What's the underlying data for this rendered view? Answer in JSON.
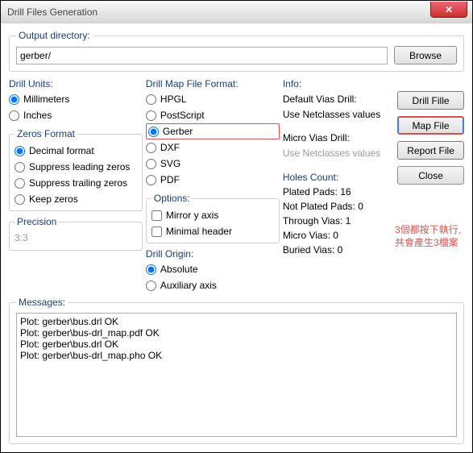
{
  "window": {
    "title": "Drill Files Generation",
    "close_glyph": "✕"
  },
  "output": {
    "legend": "Output directory:",
    "value": "gerber/",
    "browse": "Browse"
  },
  "drill_units": {
    "legend": "Drill Units:",
    "millimeters": "Millimeters",
    "inches": "Inches"
  },
  "zeros": {
    "legend": "Zeros Format",
    "decimal": "Decimal format",
    "sup_lead": "Suppress leading zeros",
    "sup_trail": "Suppress trailing zeros",
    "keep": "Keep zeros"
  },
  "precision": {
    "legend": "Precision",
    "value": "3:3"
  },
  "map_format": {
    "legend": "Drill Map File Format:",
    "hpgl": "HPGL",
    "postscript": "PostScript",
    "gerber": "Gerber",
    "dxf": "DXF",
    "svg": "SVG",
    "pdf": "PDF"
  },
  "options": {
    "legend": "Options:",
    "mirror": "Mirror y axis",
    "minimal": "Minimal header"
  },
  "origin": {
    "legend": "Drill Origin:",
    "absolute": "Absolute",
    "aux": "Auxiliary axis"
  },
  "info": {
    "legend": "Info:",
    "default_vias": "Default Vias Drill:",
    "use_net1": "Use Netclasses values",
    "micro_vias": "Micro Vias Drill:",
    "use_net2": "Use Netclasses values",
    "holes_legend": "Holes Count:",
    "plated": "Plated Pads: 16",
    "notplated": "Not Plated Pads: 0",
    "through": "Through Vias: 1",
    "micro": "Micro Vias: 0",
    "buried": "Buried Vias: 0"
  },
  "buttons": {
    "drill": "Drill Fille",
    "map": "Map File",
    "report": "Report File",
    "close": "Close"
  },
  "annotation": {
    "line1": "3個都按下執行,",
    "line2": "共會產生3檔案"
  },
  "messages": {
    "legend": "Messages:",
    "text": "Plot: gerber\\bus.drl OK\nPlot: gerber\\bus-drl_map.pdf OK\nPlot: gerber\\bus.drl OK\nPlot: gerber\\bus-drl_map.pho OK"
  }
}
